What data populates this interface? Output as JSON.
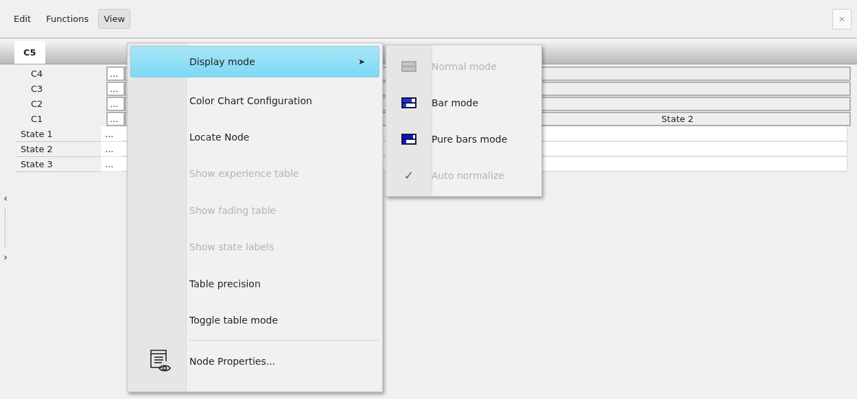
{
  "menubar": [
    {
      "label": "Edit",
      "selected": false
    },
    {
      "label": "Functions",
      "selected": false
    },
    {
      "label": "View",
      "selected": true
    }
  ],
  "close_button": {
    "label": "×"
  },
  "tabs": [
    {
      "label": "C5",
      "selected": true
    }
  ],
  "table": {
    "parent_rows": [
      {
        "label": "C4",
        "button": "..."
      },
      {
        "label": "C3",
        "button": "..."
      },
      {
        "label": "C2",
        "button": "..."
      },
      {
        "label": "C1",
        "button": "...",
        "column_2": "State 2"
      }
    ],
    "state_rows": [
      {
        "label": "State 1",
        "button": "..."
      },
      {
        "label": "State 2",
        "button": "..."
      },
      {
        "label": "State 3",
        "button": "..."
      }
    ]
  },
  "splitter": {
    "collapse": "‹",
    "expand": "›"
  },
  "view_menu": {
    "items": [
      {
        "label": "Display mode",
        "kind": "submenu",
        "selected": true,
        "disabled": false,
        "arrow": "➤"
      },
      {
        "label": "Color Chart Configuration",
        "kind": "command",
        "selected": false,
        "disabled": false
      },
      {
        "label": "Locate Node",
        "kind": "command",
        "selected": false,
        "disabled": false
      },
      {
        "label": "Show experience table",
        "kind": "command",
        "selected": false,
        "disabled": true
      },
      {
        "label": "Show fading table",
        "kind": "command",
        "selected": false,
        "disabled": true
      },
      {
        "label": "Show state labels",
        "kind": "command",
        "selected": false,
        "disabled": true
      },
      {
        "label": "Table precision",
        "kind": "command",
        "selected": false,
        "disabled": false
      },
      {
        "label": "Toggle table mode",
        "kind": "command",
        "selected": false,
        "disabled": false
      },
      {
        "kind": "separator"
      },
      {
        "label": "Node Properties...",
        "kind": "properties",
        "selected": false,
        "disabled": false
      }
    ]
  },
  "display_mode_submenu": {
    "items": [
      {
        "label": "Normal mode",
        "kind": "normal",
        "disabled": true
      },
      {
        "label": "Bar mode",
        "kind": "bar",
        "disabled": false
      },
      {
        "label": "Pure bars mode",
        "kind": "pure",
        "disabled": false
      },
      {
        "label": "Auto normalize",
        "kind": "check",
        "disabled": true,
        "checked": true,
        "check": "✓"
      }
    ]
  }
}
